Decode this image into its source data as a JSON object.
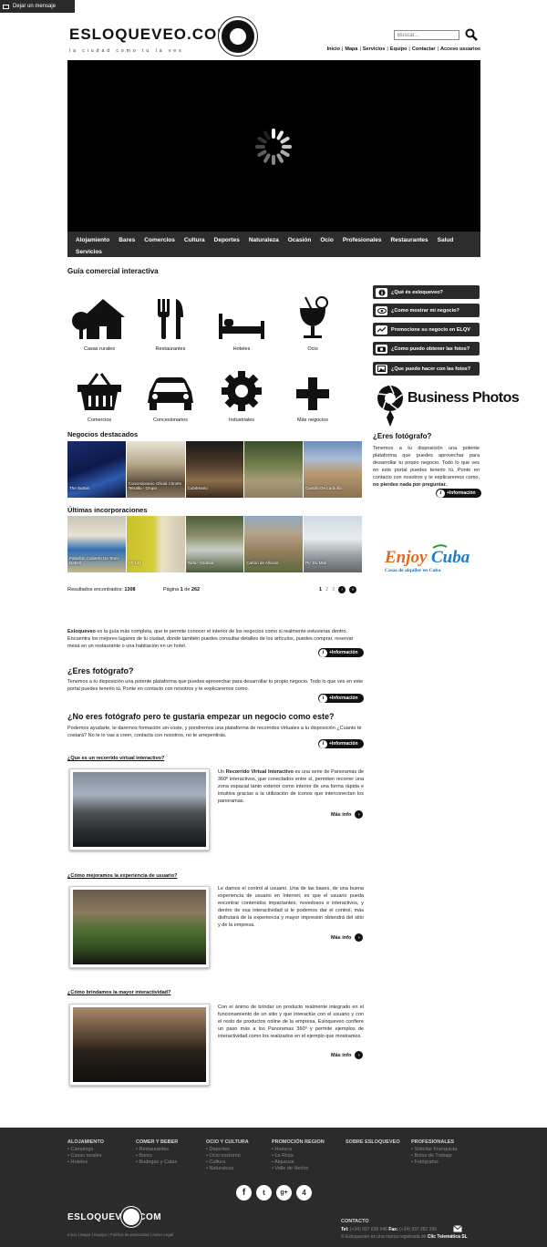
{
  "message_tab": {
    "label": "Dejar un mensaje"
  },
  "header": {
    "logo_text": "ESLOQUEVEO.COM",
    "logo_tagline": "la ciudad como tu la ves",
    "search_placeholder": "Buscar...",
    "nav": [
      "Inicio",
      "Mapa",
      "Servicios",
      "Equipo",
      "Contactar",
      "Acceso usuarios"
    ]
  },
  "category_nav": [
    "Alojamiento",
    "Bares",
    "Comercios",
    "Cultura",
    "Deportes",
    "Naturaleza",
    "Ocasión",
    "Ocio",
    "Profesionales",
    "Restaurantes",
    "Salud",
    "Servicios"
  ],
  "guide": {
    "title": "Guía comercial interactiva",
    "items": [
      {
        "label": "Casas rurales",
        "icon": "house-icon"
      },
      {
        "label": "Restaurantes",
        "icon": "cutlery-icon"
      },
      {
        "label": "Hoteles",
        "icon": "bed-icon"
      },
      {
        "label": "Ocio",
        "icon": "cocktail-icon"
      },
      {
        "label": "Comercios",
        "icon": "basket-icon"
      },
      {
        "label": "Concesionarios",
        "icon": "car-icon"
      },
      {
        "label": "Industriales",
        "icon": "gear-icon"
      },
      {
        "label": "Más negocios",
        "icon": "plus-icon"
      }
    ]
  },
  "featured": {
    "title": "Negocios destacados",
    "items": [
      "The Sutton",
      "Concesionario Oficial Citroën Terrallo - Grupo",
      "Cubitreatro",
      "",
      "Castillo De Larbuña"
    ]
  },
  "latest": {
    "title": "Últimas incorporaciones",
    "items": [
      "Pabellón Cubierto De Tenis Dabell",
      "AT 141",
      "Torla - Ordesa",
      "Cañón de Añisclo",
      "Pic Du Midi"
    ]
  },
  "results": {
    "found_label": "Resultados encontrados:",
    "found_value": "1308",
    "page_label": "Página",
    "page_value": "1",
    "page_of": "de",
    "page_total": "262",
    "pages": [
      "1",
      "2",
      "3"
    ]
  },
  "intro": {
    "text_bold": "Esloqueveo",
    "text": " es la guía más completa, que te permite conocer el interior de los negocios como si realmente estuvieras dentro. Encuentra los mejores lugares de tu ciudad, donde también puedes consultar detalles de los artículos, puedes comprar, reservar mesa en un restaurante o una habitación en un hotel.",
    "info_label": "+Información"
  },
  "photographer": {
    "title": "¿Eres fotógrafo?",
    "text": "Tenemos a tu disposición una potente plataforma que puedes aprovechar para desarrollar tu propio negocio. Todo lo que ves en este portal puedes tenerlo tú. Ponte en contacto con nosotros y te explicaremos como.",
    "info_label": "+Información"
  },
  "not_photographer": {
    "title": "¿No eres fotógrafo pero te gustaría empezar un negocio como este?",
    "text": "Podemos ayudarte, te daremos formación sin coste, y pondremos una plataforma de recorridos virtuales a tu disposición ¿Cuanto te costará? No te lo vas a creer, contacta con nosotros, no te arrepentirás.",
    "info_label": "+Información"
  },
  "features": [
    {
      "title": "¿Que es un recorrido virtual interactivo?",
      "text_pre": "Un ",
      "text_bold": "Recorrido Virtual Interactivo",
      "text": " es una serie de Panoramas de 360º interactivos, que conectados entre sí, permiten recorrer una zona espacial tanto exterior como interior de una forma rápida e intuitiva gracias a la utilización de iconos que interconectan los panoramas.",
      "more": "Más info"
    },
    {
      "title": "¿Cómo mejoramos la experiencia de usuario?",
      "text_pre": "",
      "text_bold": "",
      "text": "Le damos el control al usuario. Una de las bases, de una buena experiencia de usuario en Internet, es que el usuario pueda encontrar contenidos impactantes, novedosos e interactivos, y dentro de esa interactividad si le podemos dar el control, más disfrutará de la experiencia y mayor impresión obtendrá del sitio y de la empresa.",
      "more": "Más info"
    },
    {
      "title": "¿Cómo brindamos la mayor interactividad?",
      "text_pre": "",
      "text_bold": "",
      "text": "Con el ánimo de brindar un producto realmente integrado en el funcionamiento de un sitio y que interactúe con el usuario y con el resto de productos online de la empresa, Esloqueveo confiere un paso más a los Panoramas 360º y permite ejemplos de interactividad como los realizados en el ejemplo que mostramos.",
      "more": "Más info"
    }
  ],
  "sidebar": {
    "buttons": [
      {
        "label": "¿Qué és esloqueveo?",
        "icon": "info-icon"
      },
      {
        "label": "¿Como mostrar mi negocio?",
        "icon": "eye-icon"
      },
      {
        "label": "Promocione su negocio en ELQV",
        "icon": "chart-icon"
      },
      {
        "label": "¿Como puedo obtener las fotos?",
        "icon": "camera-icon"
      },
      {
        "label": "¿Que puedo hacer con las fotos?",
        "icon": "photo-icon"
      }
    ],
    "business_photos": "Business Photos",
    "photographer_title": "¿Eres fotógrafo?",
    "photographer_text": "Tenemos a tu disposición una potente plataforma que puedes aprovechar para desarrollar tu propio negocio. Todo lo que ves en este portal puedes tenerlo tú. Ponte en contacto con nosotros y te explicaremos como,",
    "photographer_bold": " no pierdes nada por preguntar.",
    "info_label": "+Información",
    "enjoy_title": "Enjoy Cuba",
    "enjoy_sub": "Casas de alquiler en Cuba"
  },
  "footer": {
    "columns": [
      {
        "title": "Alojamiento",
        "links": [
          "Campings",
          "Casas rurales",
          "Hoteles"
        ]
      },
      {
        "title": "Comer y beber",
        "links": [
          "Restaurantes",
          "Bares",
          "Bodegas y Catas"
        ]
      },
      {
        "title": "Ocio y cultura",
        "links": [
          "Deportes",
          "Ocio nocturno",
          "Cultura",
          "Naturaleza"
        ]
      },
      {
        "title": "Promoción region",
        "links": [
          "Huesca",
          "La Rioja",
          "Alquezar",
          "Valle de Hecho"
        ]
      },
      {
        "title": "Sobre esloqueveo",
        "links": []
      },
      {
        "title": "Profesionales",
        "links": [
          "Solicitar Franquicia",
          "Bolsa de Trabajo",
          "Fotógrafos"
        ]
      }
    ],
    "social": [
      "f",
      "t",
      "g+",
      "4"
    ],
    "logo": "ESLOQUEVEO.COM",
    "links": "Inicio | Mapa | Equipo | Política de privacidad | Aviso Legal",
    "contact_title": "CONTACTO",
    "tel_label": "Tel:",
    "tel": "(+34) 937 838 046",
    "fax_label": "Fax:",
    "fax": "(+34) 937 382 296",
    "copyright": "© Esloqueveo es una marca registrada de",
    "company": "Clic Telemática SL"
  },
  "colors": {
    "dark_bar": "#2d2d2d",
    "footer_bg": "#2b2b2b",
    "accent": "#111111"
  }
}
